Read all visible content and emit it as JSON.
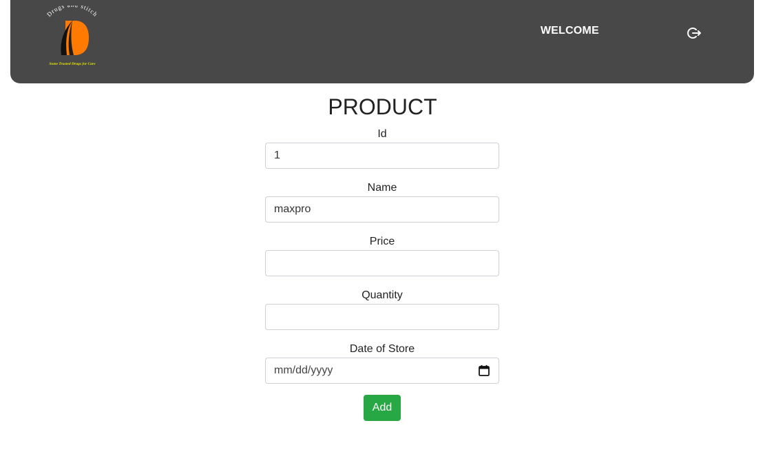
{
  "header": {
    "logo": {
      "brand_text": "Drugs and stitch",
      "tagline": "Some Trusted Drugs for Care",
      "colors": {
        "primary": "#ff7a00",
        "secondary": "#111111",
        "tagline": "#e6e600"
      }
    },
    "welcome_text": "WELCOME",
    "logout_icon": "logout-arrow-icon",
    "background_color": "#484848"
  },
  "form": {
    "title": "PRODUCT",
    "fields": {
      "id": {
        "label": "Id",
        "value": "1",
        "placeholder": ""
      },
      "name": {
        "label": "Name",
        "value": "maxpro",
        "placeholder": ""
      },
      "price": {
        "label": "Price",
        "value": "",
        "placeholder": ""
      },
      "quantity": {
        "label": "Quantity",
        "value": "",
        "placeholder": ""
      },
      "date_of_store": {
        "label": "Date of Store",
        "value": "",
        "placeholder": "mm/dd/yyyy",
        "icon": "calendar-icon"
      }
    },
    "add_button": {
      "label": "Add",
      "color": "#28a745"
    }
  }
}
